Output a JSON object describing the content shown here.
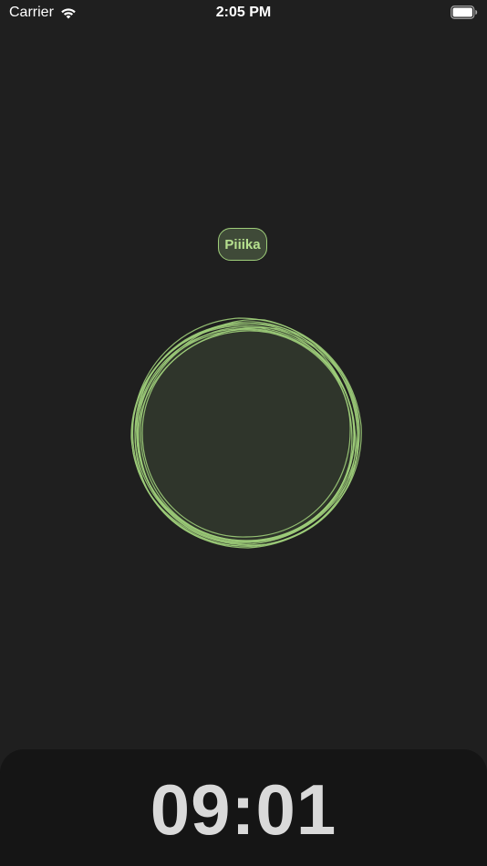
{
  "status_bar": {
    "carrier": "Carrier",
    "time": "2:05 PM",
    "wifi_icon": "wifi-icon",
    "battery_icon": "battery-full-icon"
  },
  "chip": {
    "label": "Piiika"
  },
  "timer": {
    "display": "09:01"
  },
  "colors": {
    "background": "#1f1f1f",
    "accent": "#9fce7a",
    "blob_fill": "#2f352b",
    "sheet": "#151515",
    "timer_text": "#d9d9d9"
  }
}
